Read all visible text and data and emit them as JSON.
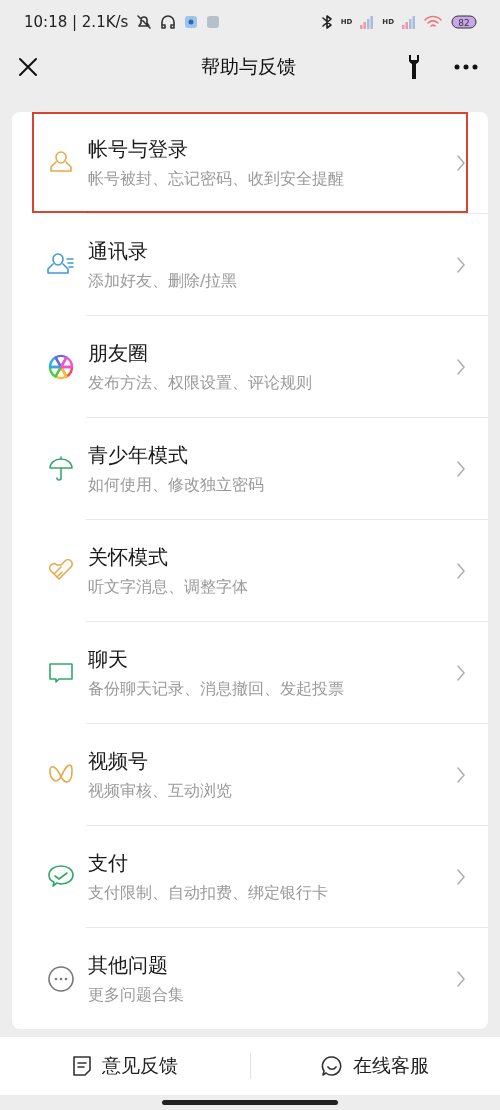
{
  "status_bar": {
    "time": "10:18 | 2.1K/s",
    "signal_labels": [
      "HD",
      "HD"
    ],
    "battery": "82"
  },
  "header": {
    "title": "帮助与反馈"
  },
  "items": [
    {
      "title": "帐号与登录",
      "subtitle": "帐号被封、忘记密码、收到安全提醒",
      "selected": true
    },
    {
      "title": "通讯录",
      "subtitle": "添加好友、删除/拉黑",
      "selected": false
    },
    {
      "title": "朋友圈",
      "subtitle": "发布方法、权限设置、评论规则",
      "selected": false
    },
    {
      "title": "青少年模式",
      "subtitle": "如何使用、修改独立密码",
      "selected": false
    },
    {
      "title": "关怀模式",
      "subtitle": "听文字消息、调整字体",
      "selected": false
    },
    {
      "title": "聊天",
      "subtitle": "备份聊天记录、消息撤回、发起投票",
      "selected": false
    },
    {
      "title": "视频号",
      "subtitle": "视频审核、互动浏览",
      "selected": false
    },
    {
      "title": "支付",
      "subtitle": "支付限制、自动扣费、绑定银行卡",
      "selected": false
    },
    {
      "title": "其他问题",
      "subtitle": "更多问题合集",
      "selected": false
    }
  ],
  "bottom_bar": [
    {
      "label": "意见反馈"
    },
    {
      "label": "在线客服"
    }
  ]
}
